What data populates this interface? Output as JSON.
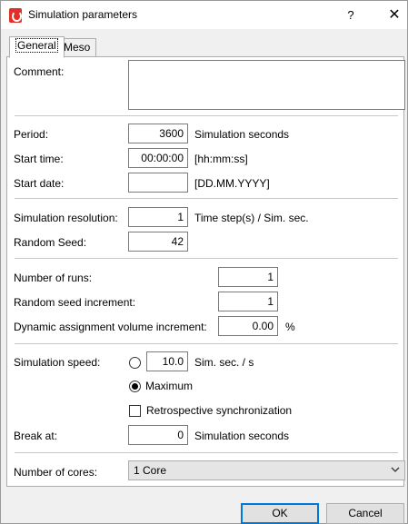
{
  "window": {
    "title": "Simulation parameters",
    "help_glyph": "?",
    "close_glyph": "✕",
    "app_icon": "vissim-app-icon"
  },
  "tabs": [
    {
      "label": "General"
    },
    {
      "label": "Meso"
    }
  ],
  "general": {
    "comment": {
      "label": "Comment:",
      "value": ""
    },
    "period": {
      "label": "Period:",
      "value": "3600",
      "unit": "Simulation seconds"
    },
    "start_time": {
      "label": "Start time:",
      "value": "00:00:00",
      "unit": "[hh:mm:ss]"
    },
    "start_date": {
      "label": "Start date:",
      "value": "",
      "unit": "[DD.MM.YYYY]"
    },
    "resolution": {
      "label": "Simulation resolution:",
      "value": "1",
      "unit": "Time step(s) / Sim. sec."
    },
    "random_seed": {
      "label": "Random Seed:",
      "value": "42"
    },
    "num_runs": {
      "label": "Number of runs:",
      "value": "1"
    },
    "seed_increment": {
      "label": "Random seed increment:",
      "value": "1"
    },
    "volume_increment": {
      "label": "Dynamic assignment volume increment:",
      "value": "0.00",
      "unit": "%"
    },
    "speed": {
      "label": "Simulation speed:",
      "value": "10.0",
      "unit": "Sim. sec. / s",
      "maximum_label": "Maximum",
      "selected": "maximum"
    },
    "retrospective_sync": {
      "label": "Retrospective synchronization",
      "checked": false
    },
    "break_at": {
      "label": "Break at:",
      "value": "0",
      "unit": "Simulation seconds"
    },
    "cores": {
      "label": "Number of cores:",
      "selected": "1 Core"
    }
  },
  "buttons": {
    "ok": "OK",
    "cancel": "Cancel"
  }
}
